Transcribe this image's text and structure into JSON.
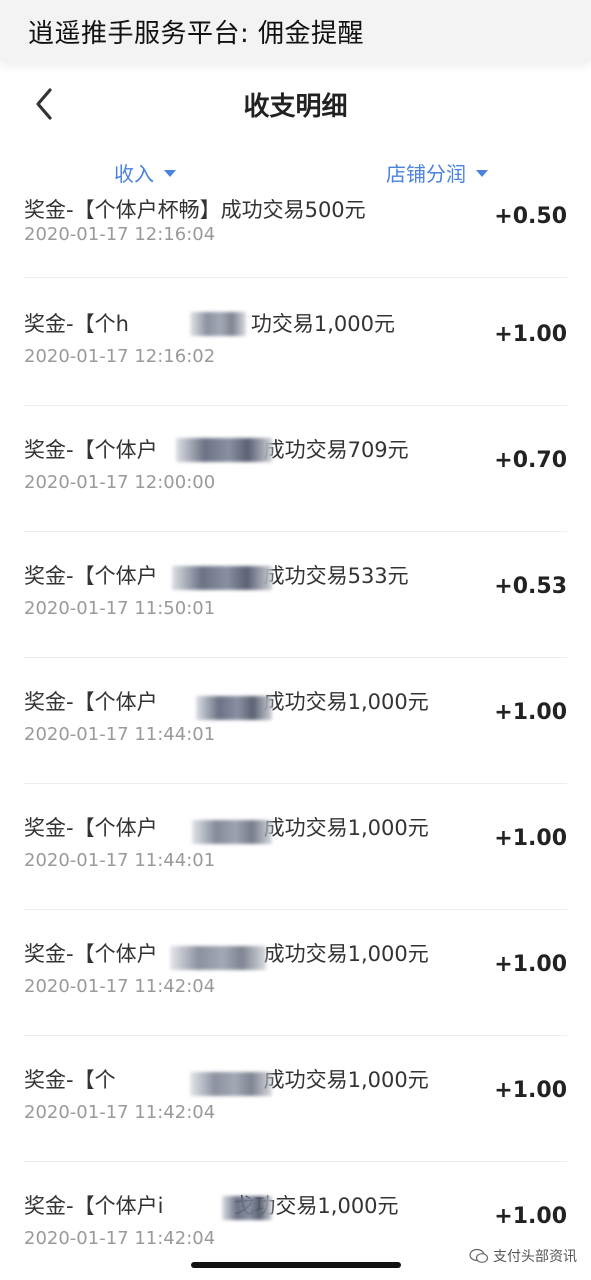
{
  "banner": {
    "text": "逍遥推手服务平台: 佣金提醒"
  },
  "header": {
    "title": "收支明细",
    "back_icon": "chevron-left-icon"
  },
  "filters": {
    "income_label": "收入",
    "shop_label": "店铺分润",
    "accent_color": "#4a82e0"
  },
  "records": [
    {
      "prefix": "奖金-【个体户杯畅",
      "suffix": "】成功交易500元",
      "time": "2020-01-17 12:16:04",
      "amount": "+0.50"
    },
    {
      "prefix": "奖金-【个h",
      "suffix": "功交易1,000元",
      "time": "2020-01-17 12:16:02",
      "amount": "+1.00"
    },
    {
      "prefix": "奖金-【个体户",
      "suffix": "成功交易709元",
      "time": "2020-01-17 12:00:00",
      "amount": "+0.70"
    },
    {
      "prefix": "奖金-【个体户",
      "suffix": "成功交易533元",
      "time": "2020-01-17 11:50:01",
      "amount": "+0.53"
    },
    {
      "prefix": "奖金-【个体户",
      "suffix": "成功交易1,000元",
      "time": "2020-01-17 11:44:01",
      "amount": "+1.00"
    },
    {
      "prefix": "奖金-【个体户",
      "suffix": "成功交易1,000元",
      "time": "2020-01-17 11:44:01",
      "amount": "+1.00"
    },
    {
      "prefix": "奖金-【个体户",
      "suffix": "成功交易1,000元",
      "time": "2020-01-17 11:42:04",
      "amount": "+1.00"
    },
    {
      "prefix": "奖金-【个",
      "suffix": "成功交易1,000元",
      "time": "2020-01-17 11:42:04",
      "amount": "+1.00"
    },
    {
      "prefix": "奖金-【个体户i",
      "suffix": "戈功交易1,000元",
      "time": "2020-01-17 11:42:04",
      "amount": "+1.00"
    }
  ],
  "watermark": {
    "text": "支付头部资讯",
    "icon": "wechat-icon"
  }
}
